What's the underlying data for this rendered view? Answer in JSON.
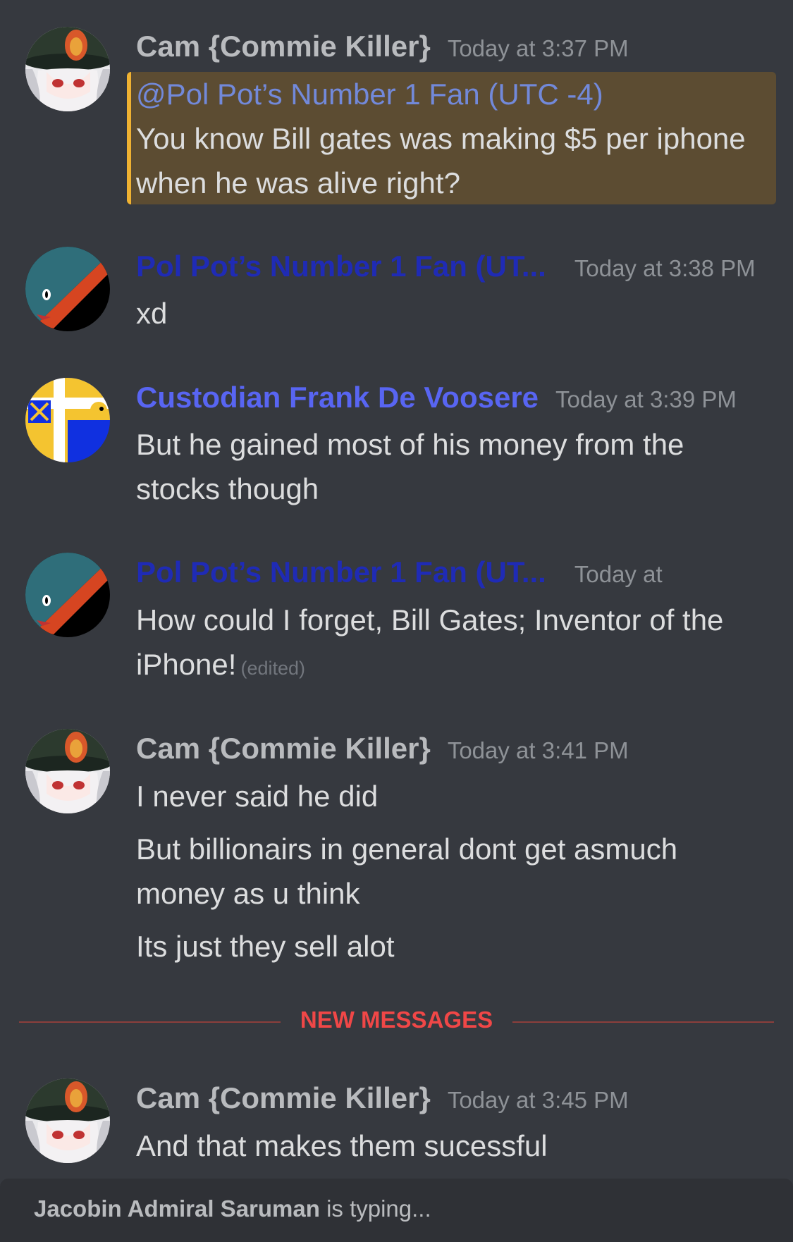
{
  "colors": {
    "background": "#36393f",
    "cam_name": "#b9bbbe",
    "polpot_name": "#1f2bb5",
    "custodian_name": "#5865f2",
    "mention": "#7289da",
    "mention_highlight": "#5c4c32",
    "new_messages": "#f04747"
  },
  "messages": [
    {
      "author": "Cam {Commie Killer}",
      "timestamp": "Today at 3:37 PM",
      "mention": "@Pol Pot’s Number 1 Fan (UTC -4)",
      "text": "You know Bill gates was making $5 per iphone when he was alive right?",
      "avatar_icon": "anime-officer-avatar-icon"
    },
    {
      "author": "Pol Pot’s Number 1 Fan (UT...",
      "timestamp": "Today at 3:38 PM",
      "text": "xd",
      "avatar_icon": "red-teal-flag-avatar-icon"
    },
    {
      "author": "Custodian Frank De Voosere",
      "timestamp": "Today at 3:39 PM",
      "text": "But he gained most of his money from the stocks though",
      "avatar_icon": "blue-yellow-flag-avatar-icon"
    },
    {
      "author": "Pol Pot’s Number 1 Fan (UT...",
      "timestamp": "Today at",
      "text": "How could I forget, Bill Gates; Inventor of the iPhone!",
      "edited": "(edited)",
      "avatar_icon": "red-teal-flag-avatar-icon"
    },
    {
      "author": "Cam {Commie Killer}",
      "timestamp": "Today at 3:41 PM",
      "lines": [
        "I never said he did",
        "But billionairs in general dont get asmuch money as u think",
        "Its just they sell alot"
      ],
      "avatar_icon": "anime-officer-avatar-icon"
    },
    {
      "author": "Cam {Commie Killer}",
      "timestamp": "Today at 3:45 PM",
      "text": "And that makes them sucessful",
      "avatar_icon": "anime-officer-avatar-icon"
    }
  ],
  "divider": {
    "label": "NEW MESSAGES"
  },
  "typing": {
    "user": "Jacobin Admiral Saruman",
    "suffix": "is typing..."
  }
}
